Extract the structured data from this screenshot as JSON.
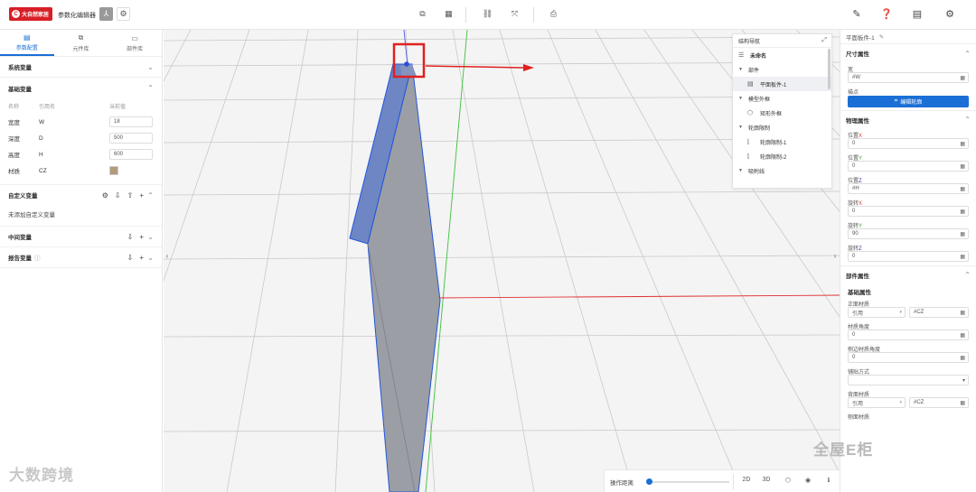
{
  "topbar": {
    "logo_text": "大自然家居",
    "app_title": "参数化编辑器",
    "colors": {
      "brand": "#d81f26",
      "accent": "#1a6fd6"
    }
  },
  "left": {
    "tabs": [
      {
        "label": "参数配置",
        "icon": "doc-icon"
      },
      {
        "label": "元件库",
        "icon": "component-icon"
      },
      {
        "label": "部件库",
        "icon": "folder-icon"
      }
    ],
    "system_vars": "系统变量",
    "base_vars": "基础变量",
    "headers": {
      "name": "名称",
      "ref": "引用名",
      "value": "当前值"
    },
    "rows": [
      {
        "name": "宽度",
        "ref": "W",
        "value": "18"
      },
      {
        "name": "深度",
        "ref": "D",
        "value": "500"
      },
      {
        "name": "高度",
        "ref": "H",
        "value": "600"
      },
      {
        "name": "材质",
        "ref": "CZ",
        "value": ""
      }
    ],
    "custom_vars": "自定义变量",
    "custom_empty": "未添加自定义变量",
    "middle_vars": "中间变量",
    "report_vars": "报告变量"
  },
  "nav": {
    "title": "结构导航",
    "items": [
      {
        "label": "未命名",
        "level": 0
      },
      {
        "label": "部件",
        "level": 1
      },
      {
        "label": "平面板件-1",
        "level": 2
      },
      {
        "label": "模型外框",
        "level": 1
      },
      {
        "label": "矩形外框",
        "level": 2
      },
      {
        "label": "轮廓限制",
        "level": 1
      },
      {
        "label": "轮廓限制-1",
        "level": 2
      },
      {
        "label": "轮廓限制-2",
        "level": 2
      },
      {
        "label": "吸附线",
        "level": 1
      }
    ]
  },
  "right": {
    "title": "平面板件-1",
    "size_section": "尺寸属性",
    "width_label": "宽",
    "width_value": "#W",
    "point_label": "描点",
    "edit_button": "编辑轮廓",
    "physics_section": "物理属性",
    "pos_x_label": "位置X",
    "pos_x": "0",
    "pos_y_label": "位置Y",
    "pos_y": "0",
    "pos_z_label": "位置Z",
    "pos_z": "#H",
    "rot_x_label": "旋转X",
    "rot_x": "0",
    "rot_y_label": "旋转Y",
    "rot_y": "90",
    "rot_z_label": "旋转Z",
    "rot_z": "0",
    "part_section": "部件属性",
    "base_sub": "基础属性",
    "front_mat_label": "正面材质",
    "front_mat_mode": "引用",
    "front_mat_value": "#CZ",
    "tex_angle_label": "材质角度",
    "tex_angle": "0",
    "side_angle_label": "侧边材质角度",
    "side_angle": "0",
    "edge_mode_label": "铺贴方式",
    "back_mat_label": "背面材质",
    "back_mat_mode": "引用",
    "back_mat_value": "#CZ",
    "side_mat_label": "侧面材质"
  },
  "bottom": {
    "op_distance_label": "操作距离",
    "btn_2d": "2D",
    "btn_3d": "3D"
  },
  "watermarks": {
    "left": "大数跨境",
    "right": "全屋E柜"
  }
}
